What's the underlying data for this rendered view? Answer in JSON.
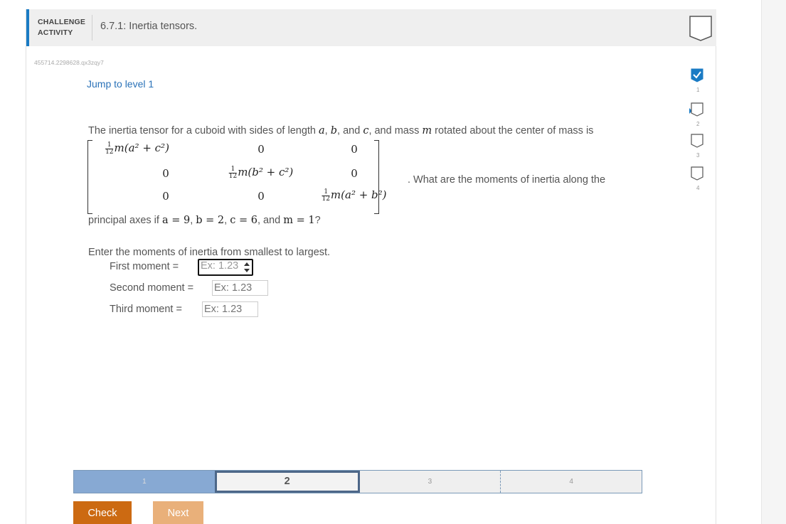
{
  "header": {
    "label_line1": "CHALLENGE",
    "label_line2": "ACTIVITY",
    "title": "6.7.1: Inertia tensors.",
    "accent_color": "#1a7bc4"
  },
  "activity_id": "455714.2298628.qx3zqy7",
  "jump_link": "Jump to level 1",
  "prompt": {
    "intro": "The inertia tensor for a cuboid with sides of length",
    "a": "a",
    "comma1": ",",
    "b": "b",
    "and1": ", and",
    "c": "c",
    "and2": ", and mass",
    "m": "m",
    "rest": "rotated about the center of mass is",
    "after_matrix": ". What are the moments of inertia along the",
    "principal_prefix": "principal axes if",
    "cond_a": "a = 9",
    "cond_sep1": ",",
    "cond_b": "b = 2",
    "cond_sep2": ",",
    "cond_c": "c = 6",
    "cond_and": ", and",
    "cond_m": "m = 1",
    "cond_q": "?"
  },
  "matrix": {
    "frac_num": "1",
    "frac_den": "12",
    "r1c1": "m(a² + c²)",
    "r1c2": "0",
    "r1c3": "0",
    "r2c1": "0",
    "r2c2": "m(b² + c²)",
    "r2c3": "0",
    "r3c1": "0",
    "r3c2": "0",
    "r3c3": "m(a² + b²)"
  },
  "instruction": "Enter the moments of inertia from smallest to largest.",
  "answers": [
    {
      "label": "First moment =",
      "placeholder": "Ex: 1.23"
    },
    {
      "label": "Second moment =",
      "placeholder": "Ex: 1.23"
    },
    {
      "label": "Third moment =",
      "placeholder": "Ex: 1.23"
    }
  ],
  "progress": {
    "levels": [
      "1",
      "2",
      "3",
      "4"
    ],
    "current": 2
  },
  "buttons": {
    "check": "Check",
    "next": "Next"
  },
  "level_sidebar": [
    "1",
    "2",
    "3",
    "4"
  ],
  "colors": {
    "check": "#cc6a12",
    "next": "#e9b07a",
    "progress_done": "#87a9d3",
    "link": "#2a72b8"
  }
}
